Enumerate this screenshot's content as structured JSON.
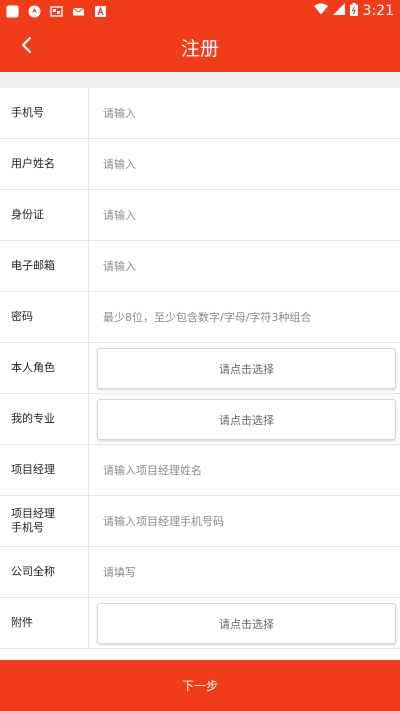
{
  "status_bar": {
    "time": "3:21",
    "icons": [
      "app-icon",
      "location-icon",
      "gallery-icon",
      "mail-icon",
      "font-icon",
      "wifi-icon",
      "signal-icon",
      "battery-icon"
    ]
  },
  "header": {
    "title": "注册",
    "back_icon": "back-arrow-icon"
  },
  "colors": {
    "primary": "#f03c19",
    "divider": "#e4e4e4",
    "placeholder": "#8a8a8a"
  },
  "form": {
    "phone": {
      "label": "手机号",
      "placeholder": "请输入"
    },
    "username": {
      "label": "用户姓名",
      "placeholder": "请输入"
    },
    "id_card": {
      "label": "身份证",
      "placeholder": "请输入"
    },
    "email": {
      "label": "电子邮箱",
      "placeholder": "请输入"
    },
    "password": {
      "label": "密码",
      "placeholder": "最少8位，至少包含数字/字母/字符3种组合"
    },
    "role": {
      "label": "本人角色",
      "button": "请点击选择"
    },
    "major": {
      "label": "我的专业",
      "button": "请点击选择"
    },
    "pm_name": {
      "label": "项目经理",
      "placeholder": "请输入项目经理姓名"
    },
    "pm_phone": {
      "label_line1": "项目经理",
      "label_line2": "手机号",
      "placeholder": "请输入项目经理手机号码"
    },
    "company": {
      "label": "公司全称",
      "placeholder": "请填写"
    },
    "attachment": {
      "label": "附件",
      "button": "请点击选择"
    }
  },
  "footer": {
    "next_label": "下一步"
  }
}
